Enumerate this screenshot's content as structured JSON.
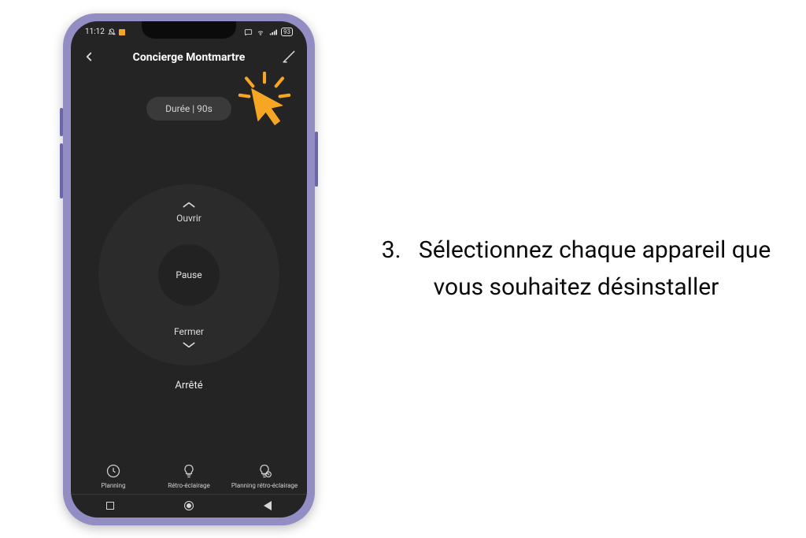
{
  "instruction": {
    "number": "3.",
    "text": "Sélectionnez chaque appareil que vous souhaitez désinstaller"
  },
  "statusbar": {
    "time": "11:12",
    "battery": "93"
  },
  "header": {
    "title": "Concierge Montmartre"
  },
  "chip": {
    "label": "Durée | 90s"
  },
  "dial": {
    "open": "Ouvrir",
    "pause": "Pause",
    "close": "Fermer",
    "status": "Arrêté"
  },
  "bottom": {
    "planning": "Planning",
    "backlight": "Rétro-éclairage",
    "planning_backlight": "Planning rétro-éclairage"
  },
  "colors": {
    "accent": "#f6a623"
  }
}
